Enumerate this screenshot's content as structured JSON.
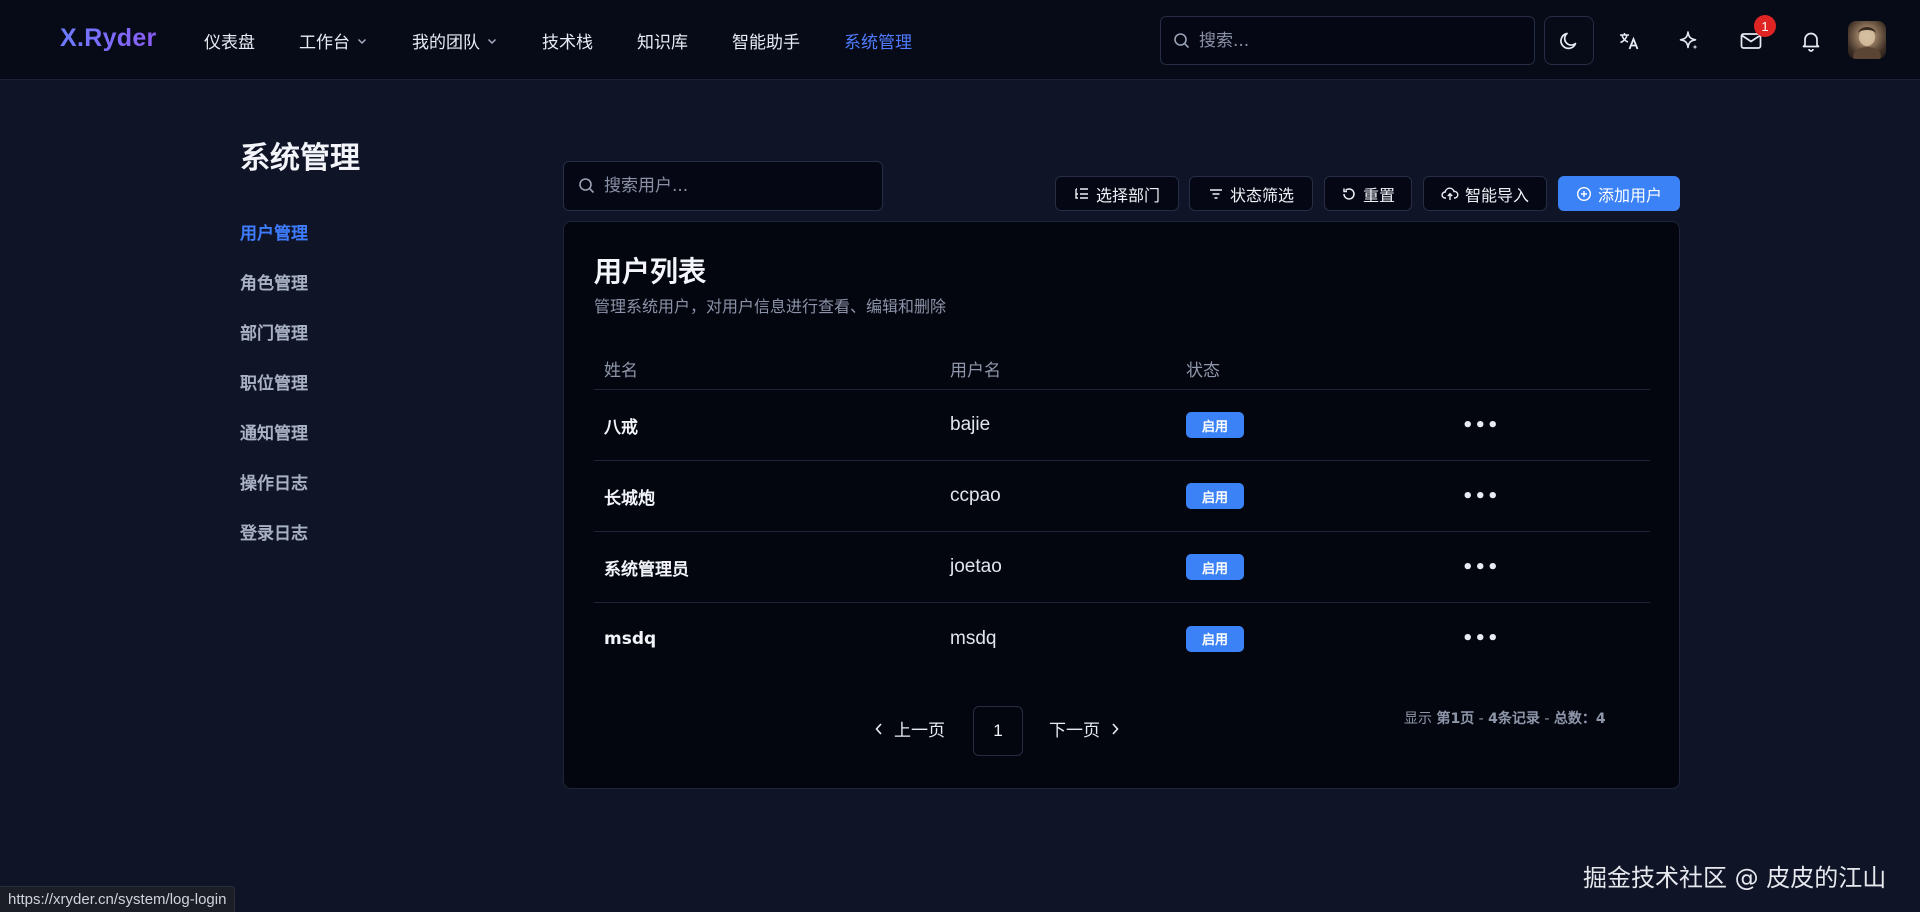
{
  "app": {
    "logo": "X.Ryder"
  },
  "nav": {
    "items": [
      {
        "label": "仪表盘",
        "dropdown": false,
        "active": false
      },
      {
        "label": "工作台",
        "dropdown": true,
        "active": false
      },
      {
        "label": "我的团队",
        "dropdown": true,
        "active": false
      },
      {
        "label": "技术栈",
        "dropdown": false,
        "active": false
      },
      {
        "label": "知识库",
        "dropdown": false,
        "active": false
      },
      {
        "label": "智能助手",
        "dropdown": false,
        "active": false
      },
      {
        "label": "系统管理",
        "dropdown": false,
        "active": true
      }
    ]
  },
  "header": {
    "search_placeholder": "搜索...",
    "icons": [
      "moon-icon",
      "translate-icon",
      "sparkle-icon",
      "mail-icon",
      "bell-icon"
    ],
    "mail_badge": "1"
  },
  "sidebar": {
    "title": "系统管理",
    "items": [
      {
        "label": "用户管理",
        "active": true
      },
      {
        "label": "角色管理",
        "active": false
      },
      {
        "label": "部门管理",
        "active": false
      },
      {
        "label": "职位管理",
        "active": false
      },
      {
        "label": "通知管理",
        "active": false
      },
      {
        "label": "操作日志",
        "active": false
      },
      {
        "label": "登录日志",
        "active": false
      }
    ]
  },
  "toolbar": {
    "search_placeholder": "搜索用户...",
    "select_dept": "选择部门",
    "status_filter": "状态筛选",
    "reset": "重置",
    "smart_import": "智能导入",
    "add_user": "添加用户"
  },
  "card": {
    "title": "用户列表",
    "subtitle": "管理系统用户，对用户信息进行查看、编辑和删除"
  },
  "table": {
    "columns": [
      "姓名",
      "用户名",
      "状态"
    ],
    "rows": [
      {
        "name": "八戒",
        "username": "bajie",
        "status": "启用"
      },
      {
        "name": "长城炮",
        "username": "ccpao",
        "status": "启用"
      },
      {
        "name": "系统管理员",
        "username": "joetao",
        "status": "启用"
      },
      {
        "name": "msdq",
        "username": "msdq",
        "status": "启用"
      }
    ],
    "more_label": "•••"
  },
  "pagination": {
    "prev": "上一页",
    "current": "1",
    "next": "下一页",
    "info_prefix": "显示",
    "info_page": "第1页",
    "info_records": "4条记录",
    "info_total": "总数：4"
  },
  "colors": {
    "accent": "#3b82f6",
    "active_nav": "#4f7bff",
    "badge": "#e02424",
    "background": "#0f1426"
  },
  "browser": {
    "status_url": "https://xryder.cn/system/log-login"
  },
  "watermark": "掘金技术社区 @ 皮皮的江山"
}
